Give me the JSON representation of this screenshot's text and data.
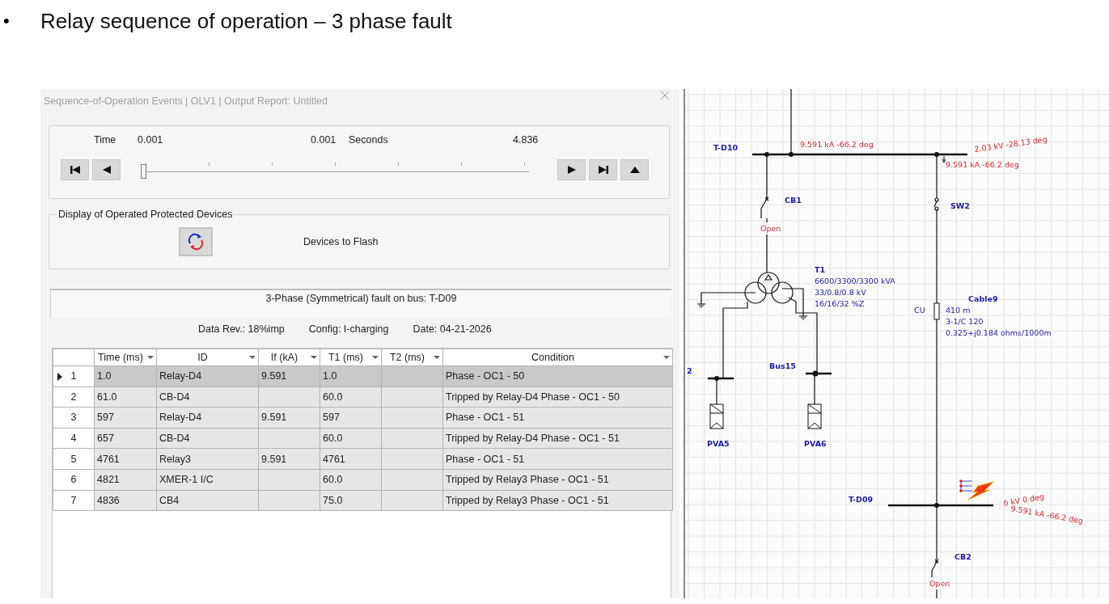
{
  "slide": {
    "bullet": "•",
    "heading": "Relay sequence of operation – 3 phase fault"
  },
  "dialog": {
    "title": "Sequence-of-Operation Events | OLV1 | Output Report: Untitled"
  },
  "time_panel": {
    "label": "Time",
    "start": "0.001",
    "current": "0.001",
    "unit": "Seconds",
    "end": "4.836",
    "level": 0.0002
  },
  "display_panel": {
    "legend": "Display of Operated Protected Devices",
    "label": "Devices to Flash"
  },
  "fault_banner": "3-Phase (Symmetrical) fault on bus: T-D09",
  "info": [
    {
      "label": "Data Rev.:",
      "value": "18%imp"
    },
    {
      "label": "Config:",
      "value": "I-charging"
    },
    {
      "label": "Date:",
      "value": "04-21-2026"
    }
  ],
  "table": {
    "columns": [
      "Time (ms)",
      "ID",
      "If (kA)",
      "T1 (ms)",
      "T2 (ms)",
      "Condition"
    ],
    "rows": [
      {
        "number": "1",
        "selected": true,
        "time": "1.0",
        "id": "Relay-D4",
        "if": "9.591",
        "t1": "1.0",
        "condition": "Phase - OC1 - 50"
      },
      {
        "number": "2",
        "selected": false,
        "time": "61.0",
        "id": "CB-D4",
        "t1": "60.0",
        "condition": "Tripped by Relay-D4 Phase - OC1 - 50"
      },
      {
        "number": "3",
        "selected": false,
        "time": "597",
        "id": "Relay-D4",
        "if": "9.591",
        "t1": "597",
        "condition": "Phase - OC1 - 51"
      },
      {
        "number": "4",
        "selected": false,
        "time": "657",
        "id": "CB-D4",
        "t1": "60.0",
        "condition": "Tripped by Relay-D4 Phase - OC1 - 51"
      },
      {
        "number": "5",
        "selected": false,
        "time": "4761",
        "id": "Relay3",
        "if": "9.591",
        "t1": "4761",
        "condition": "Phase - OC1 - 51"
      },
      {
        "number": "6",
        "selected": false,
        "time": "4821",
        "id": "XMER-1 I/C",
        "t1": "60.0",
        "condition": "Tripped by Relay3 Phase - OC1 - 51"
      },
      {
        "number": "7",
        "selected": false,
        "time": "4836",
        "id": "CB4",
        "t1": "75.0",
        "condition": "Tripped by Relay3 Phase - OC1 - 51"
      }
    ]
  },
  "diagram": {
    "labels": [
      {
        "kind": "bus",
        "text": "T-D10"
      },
      {
        "kind": "result",
        "text": "9.591 kA -66.2 deg"
      },
      {
        "kind": "result",
        "text": "2.03 kV -28.13 deg"
      },
      {
        "kind": "result",
        "text": "9.591 kA -66.2 deg"
      },
      {
        "kind": "device",
        "text": "CB1"
      },
      {
        "kind": "status",
        "text": "Open"
      },
      {
        "kind": "device",
        "text": "SW2"
      },
      {
        "kind": "device",
        "text": "T1"
      },
      {
        "kind": "rating",
        "text": "6600/3300/3300 kVA"
      },
      {
        "kind": "rating",
        "text": "33/0.8/0.8 kV"
      },
      {
        "kind": "rating",
        "text": "16/16/32 %Z"
      },
      {
        "kind": "device",
        "text": "Cable9"
      },
      {
        "kind": "rating",
        "text": "CU"
      },
      {
        "kind": "rating",
        "text": "410 m"
      },
      {
        "kind": "rating",
        "text": "3-1/C 120"
      },
      {
        "kind": "rating",
        "text": "0.325+j0.184 ohms/1000m"
      },
      {
        "kind": "device",
        "text": "2"
      },
      {
        "kind": "device",
        "text": "Bus15"
      },
      {
        "kind": "device",
        "text": "PVA5"
      },
      {
        "kind": "device",
        "text": "PVA6"
      },
      {
        "kind": "bus",
        "text": "T-D09"
      },
      {
        "kind": "result",
        "text": "0 kV 0 deg"
      },
      {
        "kind": "result",
        "text": "9.591 kA -66.2 deg"
      },
      {
        "kind": "device",
        "text": "CB2"
      },
      {
        "kind": "status",
        "text": "Open"
      }
    ]
  }
}
